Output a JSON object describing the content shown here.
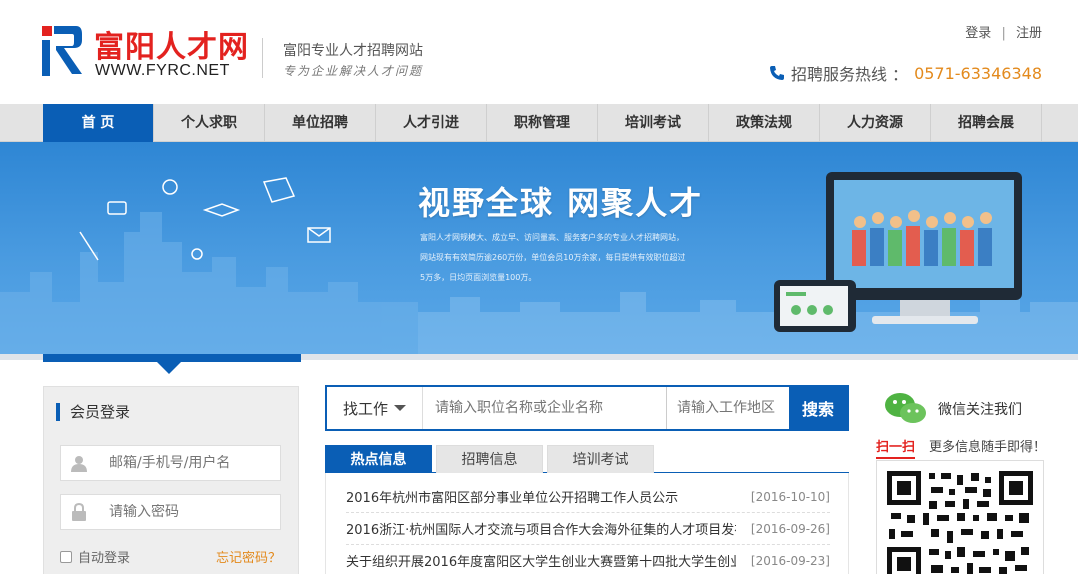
{
  "header": {
    "logo_cn": "富阳人才网",
    "logo_en": "WWW.FYRC.NET",
    "slogan": "富阳专业人才招聘网站",
    "tagline": "专为企业解决人才问题",
    "login": "登录",
    "sep": "|",
    "register": "注册",
    "hotline_label": "招聘服务热线 ：",
    "hotline_number": "0571-63346348"
  },
  "nav": {
    "items": [
      "首 页",
      "个人求职",
      "单位招聘",
      "人才引进",
      "职称管理",
      "培训考试",
      "政策法规",
      "人力资源",
      "招聘会展"
    ]
  },
  "banner": {
    "title": "视野全球  网聚人才",
    "desc": "富阳人才网规模大、成立早、访问量高、服务客户多的专业人才招聘网站，网站现有有效简历逾260万份，单位会员10万余家，每日提供有效职位超过5万多，日均页面浏览量100万。"
  },
  "login": {
    "title": "会员登录",
    "user_placeholder": "邮箱/手机号/用户名",
    "pass_placeholder": "请输入密码",
    "auto_login": "自动登录",
    "forgot": "忘记密码？"
  },
  "search": {
    "type": "找工作",
    "keyword_placeholder": "请输入职位名称或企业名称",
    "area_placeholder": "请输入工作地区",
    "button": "搜索"
  },
  "tabs": [
    "热点信息",
    "招聘信息",
    "培训考试"
  ],
  "news": [
    {
      "title": "2016年杭州市富阳区部分事业单位公开招聘工作人员公示",
      "date": "[2016-10-10]"
    },
    {
      "title": "2016浙江·杭州国际人才交流与项目合作大会海外征集的人才项目发布",
      "date": "[2016-09-26]"
    },
    {
      "title": "关于组织开展2016年度富阳区大学生创业大赛暨第十四批大学生创业",
      "date": "[2016-09-23]"
    }
  ],
  "wechat": {
    "label": "微信关注我们",
    "scan": "扫一扫",
    "more": "更多信息随手即得！"
  },
  "colors": {
    "brand_blue": "#0a5eb5",
    "brand_red": "#e3221f",
    "accent_orange": "#e38a1d"
  }
}
